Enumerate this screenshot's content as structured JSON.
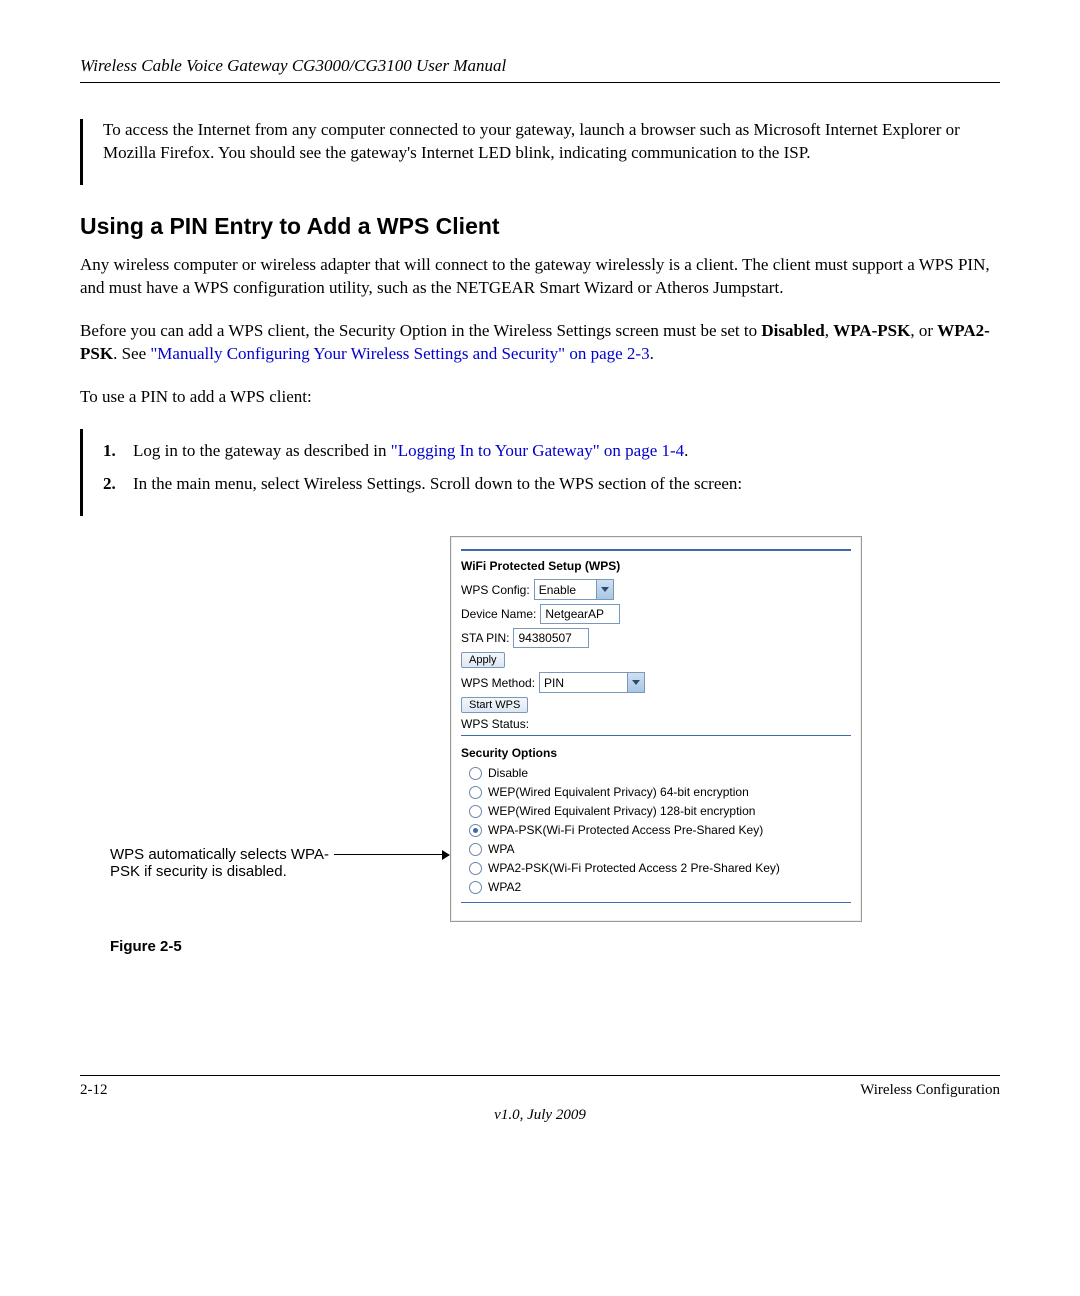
{
  "header": {
    "title": "Wireless Cable Voice Gateway CG3000/CG3100 User Manual"
  },
  "intro_para": "To access the Internet from any computer connected to your gateway, launch a browser such as Microsoft Internet Explorer or Mozilla Firefox. You should see the gateway's Internet LED blink, indicating communication to the ISP.",
  "section_title": "Using a PIN Entry to Add a WPS Client",
  "para1": "Any wireless computer or wireless adapter that will connect to the gateway wirelessly is a client. The client must support a WPS PIN, and must have a WPS configuration utility, such as the NETGEAR Smart Wizard or Atheros Jumpstart.",
  "para2_pre": "Before you can add a WPS client, the Security Option in the Wireless Settings screen must be set to ",
  "para2_b1": "Disabled",
  "para2_b2": "WPA-PSK",
  "para2_b3": "WPA2-PSK",
  "para2_mid": ". See ",
  "para2_link": "\"Manually Configuring Your Wireless Settings and Security\" on page 2-3",
  "para2_end": ".",
  "para3": "To use a PIN to add a WPS client:",
  "step1_pre": "Log in to the gateway as described in ",
  "step1_link": "\"Logging In to Your Gateway\" on page 1-4",
  "step1_end": ".",
  "step2": "In the main menu, select Wireless Settings. Scroll down to the WPS section of the screen:",
  "callout": "WPS automatically selects WPA-PSK if security is disabled.",
  "panel": {
    "wps_title": "WiFi Protected Setup (WPS)",
    "wps_config_label": "WPS Config:",
    "wps_config_value": "Enable",
    "device_name_label": "Device Name:",
    "device_name_value": "NetgearAP",
    "sta_pin_label": "STA PIN:",
    "sta_pin_value": "94380507",
    "apply_label": "Apply",
    "wps_method_label": "WPS Method:",
    "wps_method_value": "PIN",
    "start_wps_label": "Start WPS",
    "wps_status_label": "WPS Status:",
    "sec_title": "Security Options",
    "opts": [
      "Disable",
      "WEP(Wired Equivalent Privacy) 64-bit encryption",
      "WEP(Wired Equivalent Privacy) 128-bit encryption",
      "WPA-PSK(Wi-Fi Protected Access Pre-Shared Key)",
      "WPA",
      "WPA2-PSK(Wi-Fi Protected Access 2 Pre-Shared Key)",
      "WPA2"
    ]
  },
  "figure_caption": "Figure 2-5",
  "footer": {
    "page": "2-12",
    "section": "Wireless Configuration",
    "version": "v1.0, July 2009"
  }
}
